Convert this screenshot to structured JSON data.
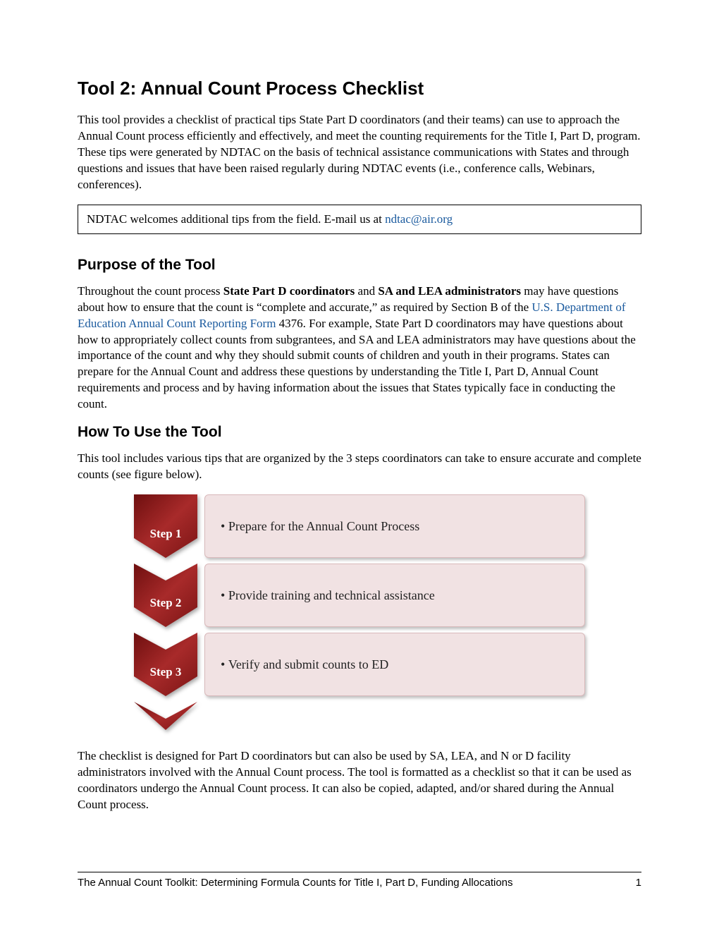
{
  "title": "Tool 2: Annual Count Process Checklist",
  "intro": "This tool provides a checklist of practical tips State Part D coordinators (and their teams) can use to approach the Annual Count process efficiently and effectively, and meet the counting requirements for the Title I, Part D, program. These tips were generated by NDTAC on the basis of technical assistance communications with States and through questions and issues that have been raised regularly during NDTAC events (i.e., conference calls, Webinars, conferences).",
  "tipbox": {
    "pre": "NDTAC welcomes additional tips from the field. E-mail us at ",
    "email": "ndtac@air.org"
  },
  "purpose": {
    "heading": "Purpose of the Tool",
    "p1a": "Throughout the count process ",
    "bold1": "State Part D coordinators",
    "p1b": " and ",
    "bold2": "SA and LEA administrators",
    "p1c": " may have questions about how to ensure that the count is “complete and accurate,” as required by Section B of the ",
    "link": "U.S. Department of Education Annual Count Reporting Form",
    "p1d": " 4376. For example, State Part D coordinators may have questions about how to appropriately collect counts from subgrantees, and SA and LEA administrators may have questions about the importance of the count and why they should submit counts of children and youth in their programs. States can prepare for the Annual Count and address these questions by understanding the Title I, Part D, Annual Count requirements and process and by having information about the issues that States typically face in conducting the count."
  },
  "howto": {
    "heading": "How To Use the Tool",
    "p": "This tool includes various tips that are organized by the 3 steps coordinators can take to ensure accurate and complete counts (see figure below)."
  },
  "steps": [
    {
      "label": "Step 1",
      "text": "Prepare for the Annual Count Process"
    },
    {
      "label": "Step 2",
      "text": "Provide training and technical assistance"
    },
    {
      "label": "Step 3",
      "text": "Verify and submit counts to ED"
    }
  ],
  "closing": "The checklist is designed for Part D coordinators but can also be used by SA, LEA, and N or D facility administrators involved with the Annual Count process. The tool is formatted as a checklist so that it can be used as coordinators undergo the Annual Count process. It can also be copied, adapted, and/or shared during the Annual Count process.",
  "footer": {
    "left": "The Annual Count Toolkit: Determining Formula Counts for Title I, Part D, Funding Allocations",
    "right": "1"
  },
  "colors": {
    "chevron_dark": "#8a1a1a",
    "chevron_light": "#b33a3a",
    "stepbox_bg": "#f1e2e3",
    "link": "#1a5a9e"
  }
}
